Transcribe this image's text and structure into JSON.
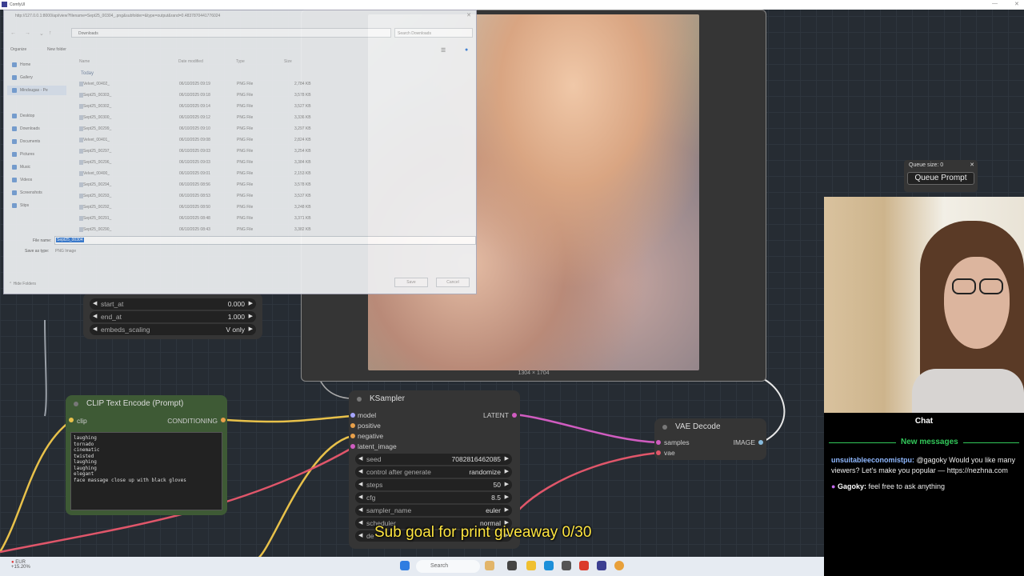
{
  "app": {
    "title": "ComfyUI"
  },
  "dialog": {
    "url": "http://127.0.0.1:8000/api/view?filename=Sept25_00304_.png&subfolder=&type=output&rand=0.4837870441776024",
    "address": "Downloads",
    "search_placeholder": "Search Downloads",
    "organize": "Organize",
    "new_folder": "New folder",
    "nav_items": [
      "Home",
      "Gallery",
      "Mindsugas - Pe",
      "Desktop",
      "Downloads",
      "Documents",
      "Pictures",
      "Music",
      "Videos",
      "Screenshots",
      "Stips"
    ],
    "columns": [
      "Name",
      "Date modified",
      "Type",
      "Size"
    ],
    "group": "Today",
    "files": [
      {
        "name": "Velvet_00402_",
        "date": "06/10/2025 09:19",
        "type": "PNG File",
        "size": "2,784 KB"
      },
      {
        "name": "Sept25_00303_",
        "date": "06/10/2025 09:18",
        "type": "PNG File",
        "size": "3,578 KB"
      },
      {
        "name": "Sept25_00302_",
        "date": "06/10/2025 09:14",
        "type": "PNG File",
        "size": "3,527 KB"
      },
      {
        "name": "Sept25_00300_",
        "date": "06/10/2025 09:12",
        "type": "PNG File",
        "size": "3,336 KB"
      },
      {
        "name": "Sept25_00299_",
        "date": "06/10/2025 09:10",
        "type": "PNG File",
        "size": "3,297 KB"
      },
      {
        "name": "Velvet_00401_",
        "date": "06/10/2025 09:08",
        "type": "PNG File",
        "size": "2,824 KB"
      },
      {
        "name": "Sept25_00297_",
        "date": "06/10/2025 09:03",
        "type": "PNG File",
        "size": "3,254 KB"
      },
      {
        "name": "Sept25_00296_",
        "date": "06/10/2025 09:03",
        "type": "PNG File",
        "size": "3,384 KB"
      },
      {
        "name": "Velvet_00400_",
        "date": "06/10/2025 09:01",
        "type": "PNG File",
        "size": "2,153 KB"
      },
      {
        "name": "Sept25_00294_",
        "date": "06/10/2025 08:56",
        "type": "PNG File",
        "size": "3,578 KB"
      },
      {
        "name": "Sept25_00293_",
        "date": "06/10/2025 08:53",
        "type": "PNG File",
        "size": "3,537 KB"
      },
      {
        "name": "Sept25_00292_",
        "date": "06/10/2025 08:50",
        "type": "PNG File",
        "size": "3,248 KB"
      },
      {
        "name": "Sept25_00291_",
        "date": "06/10/2025 08:48",
        "type": "PNG File",
        "size": "3,371 KB"
      },
      {
        "name": "Sept25_00290_",
        "date": "06/10/2025 08:43",
        "type": "PNG File",
        "size": "3,382 KB"
      }
    ],
    "file_name_label": "File name:",
    "file_name": "Sept25_00304",
    "save_type_label": "Save as type:",
    "save_type": "PNG Image",
    "hide_folders": "Hide Folders",
    "save": "Save",
    "cancel": "Cancel"
  },
  "conditioning_node": {
    "widgets": [
      {
        "label": "start_at",
        "value": "0.000"
      },
      {
        "label": "end_at",
        "value": "1.000"
      },
      {
        "label": "embeds_scaling",
        "value": "V only"
      }
    ]
  },
  "clip_node": {
    "title": "CLIP Text Encode (Prompt)",
    "input": "clip",
    "output": "CONDITIONING",
    "prompt": "laughing\ntornado\ncinematic\ntwisted\nlaughing\nlaughing\nelegant\nface massage close up with black gloves"
  },
  "ksampler": {
    "title": "KSampler",
    "inputs": [
      "model",
      "positive",
      "negative",
      "latent_image"
    ],
    "output": "LATENT",
    "widgets": [
      {
        "label": "seed",
        "value": "708281646208​5"
      },
      {
        "label": "control after generate",
        "value": "randomize"
      },
      {
        "label": "steps",
        "value": "50"
      },
      {
        "label": "cfg",
        "value": "8.5"
      },
      {
        "label": "sampler_name",
        "value": "euler"
      },
      {
        "label": "scheduler",
        "value": "normal"
      },
      {
        "label": "denoise",
        "value": ""
      }
    ]
  },
  "vae": {
    "title": "VAE Decode",
    "inputs": [
      "samples",
      "vae"
    ],
    "output": "IMAGE"
  },
  "preview": {
    "dimensions": "1304 × 1704"
  },
  "queue": {
    "size_label": "Queue size: 0",
    "button": "Queue Prompt"
  },
  "chat": {
    "title": "Chat",
    "new_messages": "New messages",
    "messages": [
      {
        "user": "unsuitableeconomistpu:",
        "text": " @gagoky Would you like many viewers? Let's make you popular — https://nezhna.com"
      },
      {
        "user": "Gagoky:",
        "text": " feel free to ask anything"
      }
    ]
  },
  "overlay": {
    "goal": "Sub goal for print giveaway 0/30"
  },
  "taskbar": {
    "search": "Search",
    "weather": "EUR\n+15.20%"
  },
  "colors": {
    "accent_green": "#32c85a",
    "goal_yellow": "#ffe640",
    "chat_user": "#8fb8ff"
  }
}
